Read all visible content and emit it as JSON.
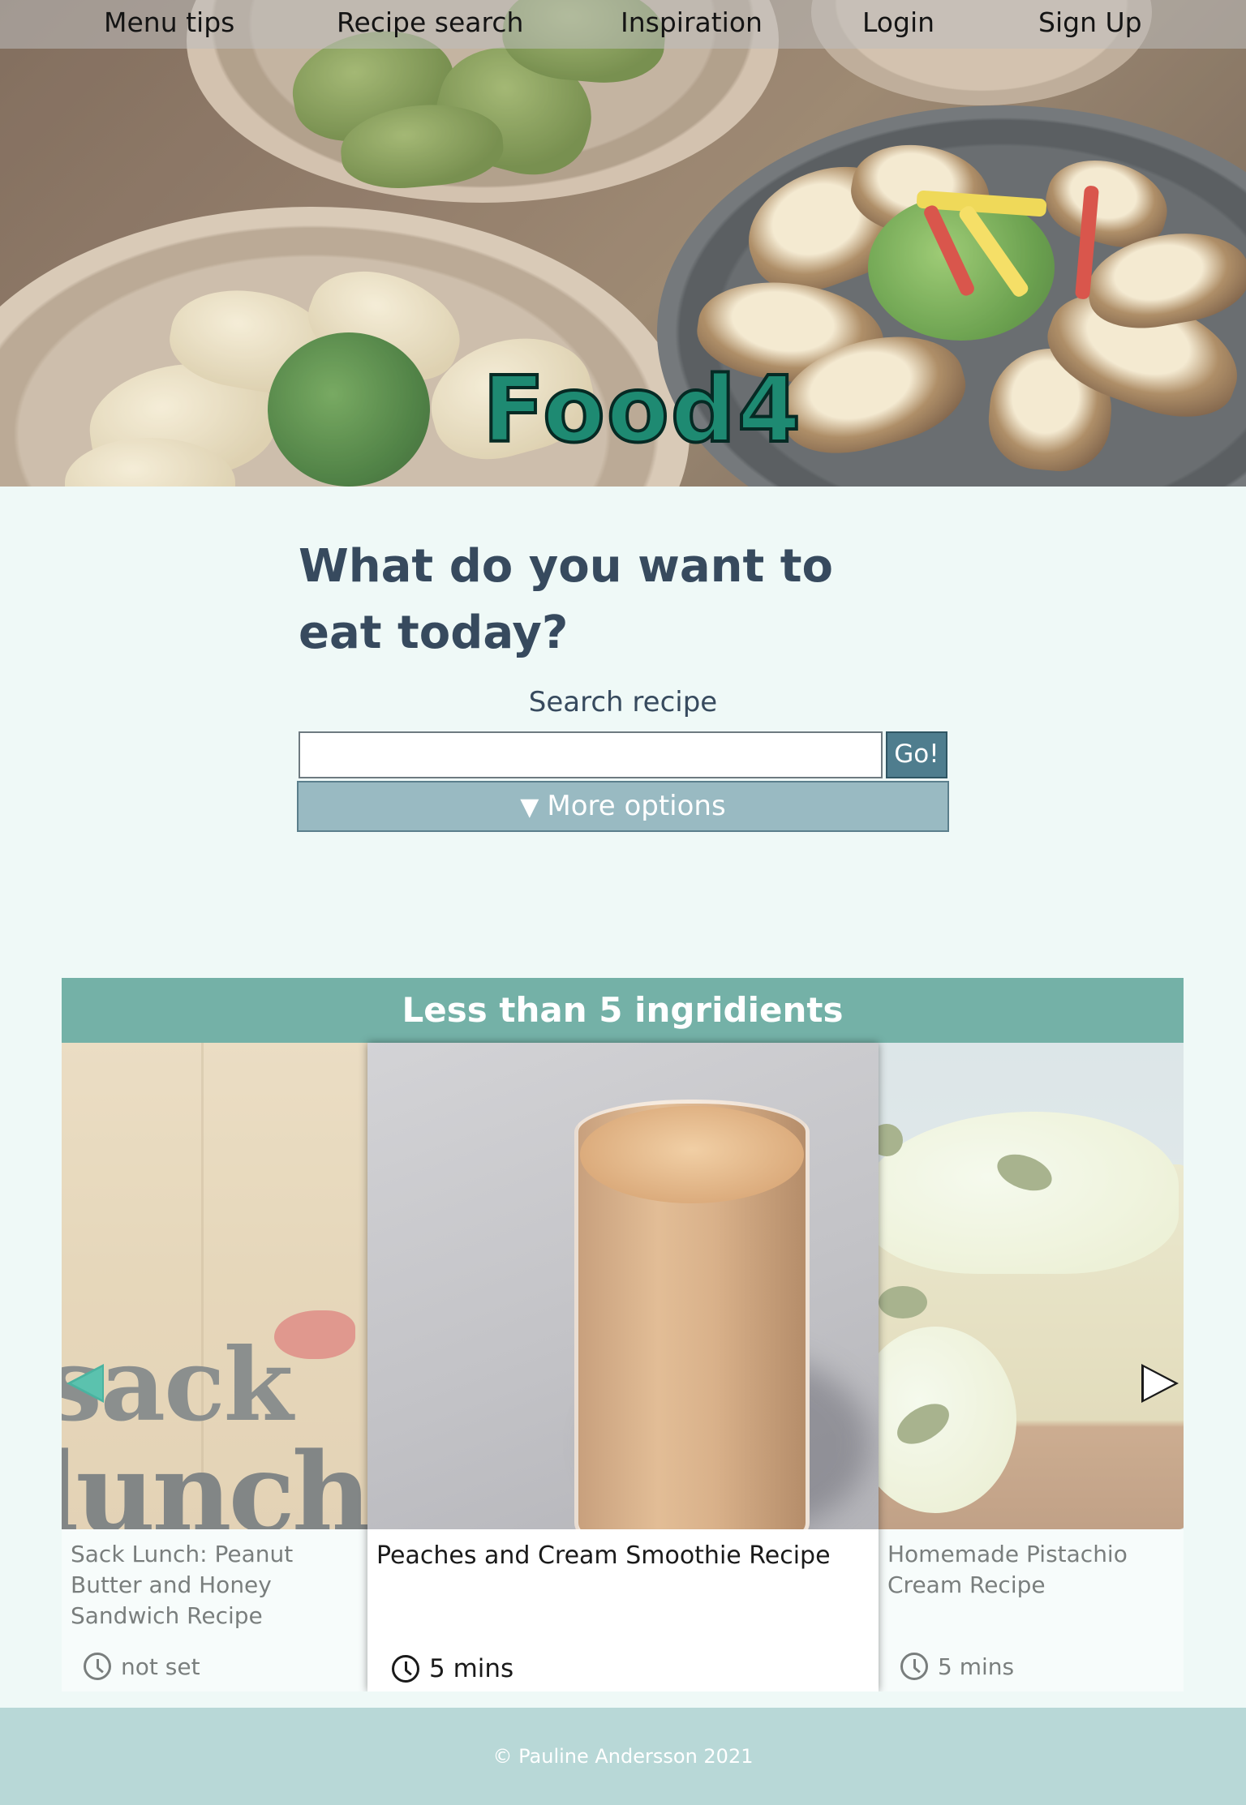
{
  "nav": {
    "items": [
      {
        "label": "Menu tips"
      },
      {
        "label": "Recipe search"
      },
      {
        "label": "Inspiration"
      },
      {
        "label": "Login"
      },
      {
        "label": "Sign Up"
      }
    ]
  },
  "hero": {
    "logo": "Food4"
  },
  "search": {
    "heading": "What do you want to eat today?",
    "label": "Search recipe",
    "input_value": "",
    "go_label": "Go!",
    "more_options_icon": "triangle-down-icon",
    "more_options_label": "More options"
  },
  "carousel": {
    "title": "Less than 5 ingridients",
    "cards": [
      {
        "title": "Sack Lunch: Peanut Butter and Honey Sandwich Recipe",
        "time": "not set",
        "image_text_1": "sack",
        "image_text_2": "lunch"
      },
      {
        "title": "Peaches and Cream Smoothie Recipe",
        "time": "5 mins"
      },
      {
        "title": "Homemade Pistachio Cream Recipe",
        "time": "5 mins"
      }
    ],
    "prev_icon": "arrow-left-icon",
    "next_icon": "arrow-right-icon",
    "accent_color": "#74b1a7"
  },
  "footer": {
    "text": "© Pauline Andersson 2021"
  }
}
